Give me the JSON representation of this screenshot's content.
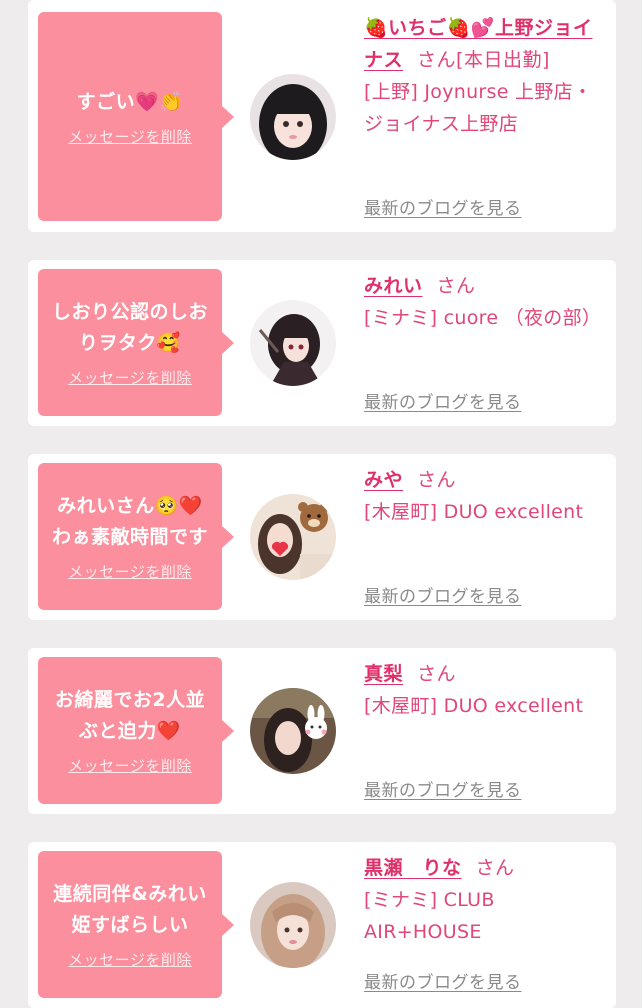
{
  "delete_label": "メッセージを削除",
  "blog_label": "最新のブログを見る",
  "honorific": "さん",
  "cards": [
    {
      "message": "すごい💗👏",
      "name": "🍓いちご🍓💕上野ジョイナス",
      "suffix": "[本日出勤]",
      "shop": "[上野] Joynurse 上野店・ジョイナス上野店"
    },
    {
      "message": "しおり公認のしおりヲタク🥰",
      "name": "みれい",
      "suffix": "",
      "shop": "[ミナミ] cuore （夜の部）"
    },
    {
      "message": "みれいさん🥺❤️わぁ素敵時間です",
      "name": "みや",
      "suffix": "",
      "shop": "[木屋町] DUO excellent"
    },
    {
      "message": "お綺麗でお2人並ぶと迫力❤️",
      "name": "真梨",
      "suffix": "",
      "shop": "[木屋町] DUO excellent"
    },
    {
      "message": "連続同伴&みれい姫すばらしい",
      "name": "黒瀬　りな",
      "suffix": "",
      "shop": "[ミナミ] CLUB AIR+HOUSE"
    }
  ],
  "colors": {
    "page_bg": "#efeced",
    "bubble": "#fc8f9d",
    "name": "#e0306a",
    "link_gray": "#8a8a8a"
  }
}
